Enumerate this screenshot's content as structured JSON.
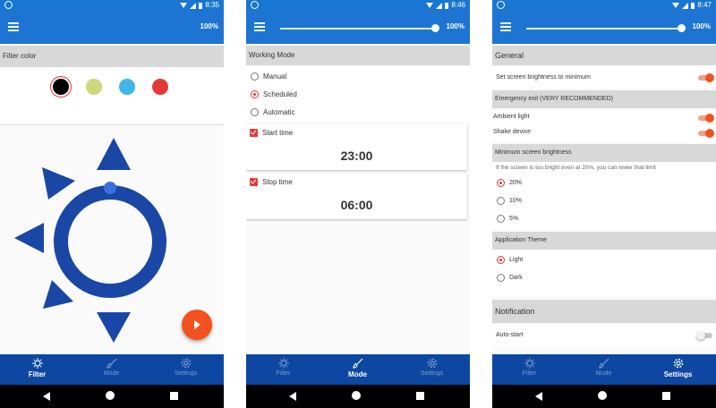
{
  "status": {
    "phone1_time": "8:35",
    "phone2_time": "8:46",
    "phone3_time": "8:47"
  },
  "brightness": {
    "value": "100%",
    "level": 1.0
  },
  "nav": {
    "filter": "Filter",
    "mode": "Mode",
    "settings": "Settings"
  },
  "filter_screen": {
    "section_title": "Filter color",
    "swatches": [
      {
        "color": "#000000",
        "selected": true
      },
      {
        "color": "#cdd87a",
        "selected": false
      },
      {
        "color": "#3fb6e8",
        "selected": false
      },
      {
        "color": "#e53935",
        "selected": false
      }
    ],
    "logo_color": "#1a47a6",
    "fab_color": "#f4511e"
  },
  "mode_screen": {
    "section_title": "Working Mode",
    "options": [
      {
        "label": "Manual",
        "selected": false
      },
      {
        "label": "Scheduled",
        "selected": true
      },
      {
        "label": "Automatic",
        "selected": false
      }
    ],
    "start_label": "Start time",
    "start_time": "23:00",
    "stop_label": "Stop time",
    "stop_time": "06:00"
  },
  "settings_screen": {
    "general_title": "General",
    "set_min_brightness": "Set screen brightness to minimum",
    "emergency_title": "Emergency exit (VERY RECOMMENDED)",
    "ambient_light": "Ambient light",
    "shake_device": "Shake device",
    "min_brightness_title": "Minimum screen brightness",
    "min_brightness_desc": "If the screen is too bright even at 20%, you can lower that limit",
    "brightness_options": [
      {
        "label": "20%",
        "selected": true
      },
      {
        "label": "10%",
        "selected": false
      },
      {
        "label": "5%",
        "selected": false
      }
    ],
    "theme_title": "Application Theme",
    "theme_options": [
      {
        "label": "Light",
        "selected": true
      },
      {
        "label": "Dark",
        "selected": false
      }
    ],
    "notification_title": "Notification",
    "auto_start": "Auto-start"
  },
  "colors": {
    "appbar": "#1e74d3",
    "bottomnav": "#0d47a1",
    "accent": "#e53935",
    "toggle_on": "#f4511e"
  }
}
